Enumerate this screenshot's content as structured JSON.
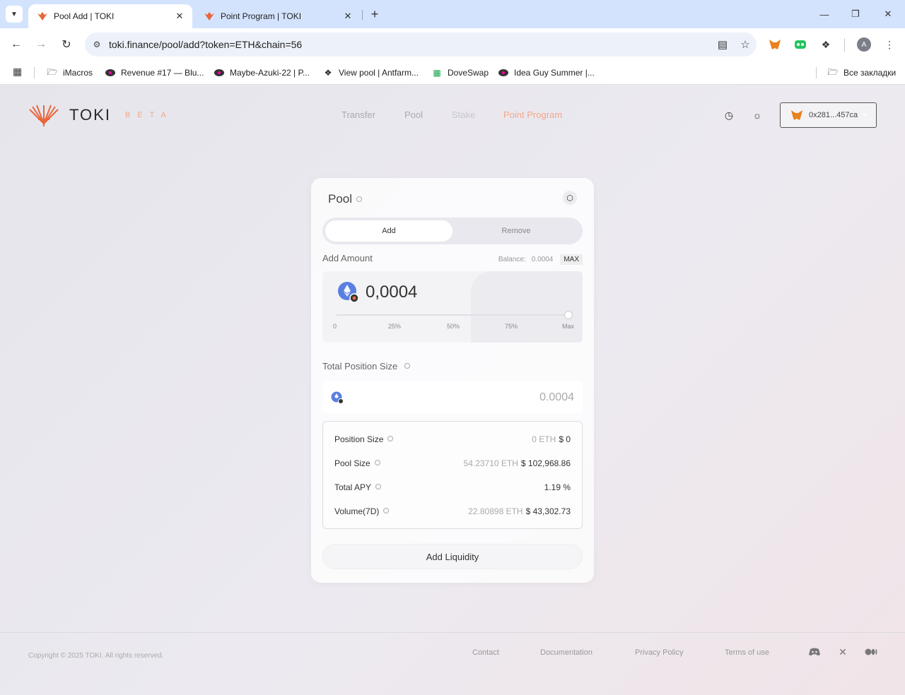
{
  "browser": {
    "tabs": [
      {
        "title": "Pool Add | TOKI",
        "active": true
      },
      {
        "title": "Point Program | TOKI",
        "active": false
      }
    ],
    "url": "toki.finance/pool/add?token=ETH&chain=56",
    "bookmarks": [
      {
        "label": "iMacros"
      },
      {
        "label": "Revenue #17 — Blu..."
      },
      {
        "label": "Maybe-Azuki-22 | P..."
      },
      {
        "label": "View pool | Antfarm..."
      },
      {
        "label": "DoveSwap"
      },
      {
        "label": "Idea Guy Summer |..."
      }
    ],
    "all_bookmarks": "Все закладки",
    "avatar_letter": "A"
  },
  "header": {
    "logo_text": "TOKI",
    "logo_beta": "BETA",
    "nav": [
      "Transfer",
      "Pool",
      "Stake",
      "Point Program"
    ],
    "wallet_address": "0x281...457ca",
    "accent": "#e8673c"
  },
  "pool": {
    "title": "Pool",
    "tabs": {
      "add": "Add",
      "remove": "Remove"
    },
    "add_amount_label": "Add Amount",
    "balance_label": "Balance:",
    "balance_value": "0.0004",
    "max_label": "MAX",
    "amount": "0,0004",
    "slider_fraction": 1.0,
    "slider_ticks": [
      "0",
      "25%",
      "50%",
      "75%",
      "Max"
    ],
    "total_position_label": "Total Position Size",
    "total_position_value": "0.0004",
    "stats": [
      {
        "name": "Position Size",
        "muted": "0 ETH",
        "value": "$ 0"
      },
      {
        "name": "Pool Size",
        "muted": "54.23710 ETH",
        "value": "$ 102,968.86"
      },
      {
        "name": "Total APY",
        "muted": "",
        "value": "1.19 %"
      },
      {
        "name": "Volume(7D)",
        "muted": "22.80898 ETH",
        "value": "$ 43,302.73"
      }
    ],
    "add_liquidity": "Add Liquidity"
  },
  "footer": {
    "copyright": "Copyright © 2025 TOKI. All rights reserved.",
    "links": [
      "Contact",
      "Documentation",
      "Privacy Policy",
      "Terms of use"
    ],
    "social_icons": [
      "discord-icon",
      "x-icon",
      "medium-icon"
    ]
  }
}
